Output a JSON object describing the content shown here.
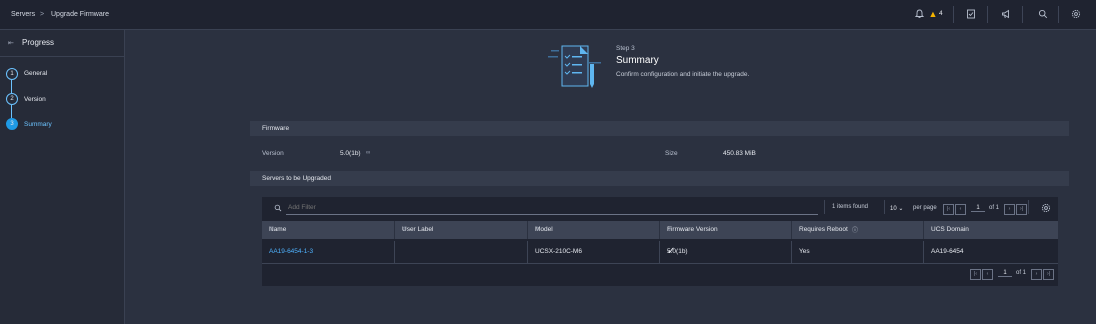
{
  "breadcrumb": {
    "root": "Servers",
    "separator": ">",
    "current": "Upgrade Firmware"
  },
  "topbar": {
    "alert_count": "4",
    "icons": [
      "bell-icon",
      "warning-icon",
      "tasks-icon",
      "announce-icon",
      "search-icon",
      "settings-icon"
    ]
  },
  "sidebar": {
    "title": "Progress",
    "steps": [
      {
        "number": "1",
        "label": "General"
      },
      {
        "number": "2",
        "label": "Version"
      },
      {
        "number": "3",
        "label": "Summary"
      }
    ]
  },
  "header": {
    "step": "Step 3",
    "title": "Summary",
    "description": "Confirm configuration and initiate the upgrade."
  },
  "firmware": {
    "section_title": "Firmware",
    "version_label": "Version",
    "version_value": "5.0(1b)",
    "size_label": "Size",
    "size_value": "450.83 MiB"
  },
  "servers": {
    "section_title": "Servers to be Upgraded",
    "filter_placeholder": "Add Filter",
    "items_found": "1 items found",
    "per_page_value": "10",
    "per_page_label": "per page",
    "page_current": "1",
    "page_of": "of 1",
    "columns": [
      "Name",
      "User Label",
      "Model",
      "Firmware Version",
      "Requires Reboot",
      "UCS Domain"
    ],
    "rows": [
      {
        "name": "AA19-6454-1-3",
        "user_label": "",
        "model": "UCSX-210C-M6",
        "firmware_version": "5.0(1b)",
        "requires_reboot": "Yes",
        "ucs_domain": "AA19-6454"
      }
    ],
    "footer_page_current": "1",
    "footer_page_of": "of 1"
  },
  "colors": {
    "accent": "#6cc3ff",
    "link": "#4fb3ff",
    "warning": "#f5b400",
    "active_step": "#1f9ae5"
  }
}
